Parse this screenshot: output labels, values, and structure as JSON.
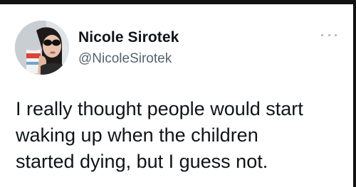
{
  "author": {
    "display_name": "Nicole Sirotek",
    "handle": "@NicoleSirotek",
    "avatar_icon": "profile-photo"
  },
  "menu": {
    "icon": "more-options-icon"
  },
  "tweet": {
    "lines": [
      "I really thought people would start",
      "waking up when the children",
      "started dying, but I guess not."
    ]
  },
  "colors": {
    "text_primary": "#0f1419",
    "text_secondary": "#536471",
    "border": "#111111"
  }
}
